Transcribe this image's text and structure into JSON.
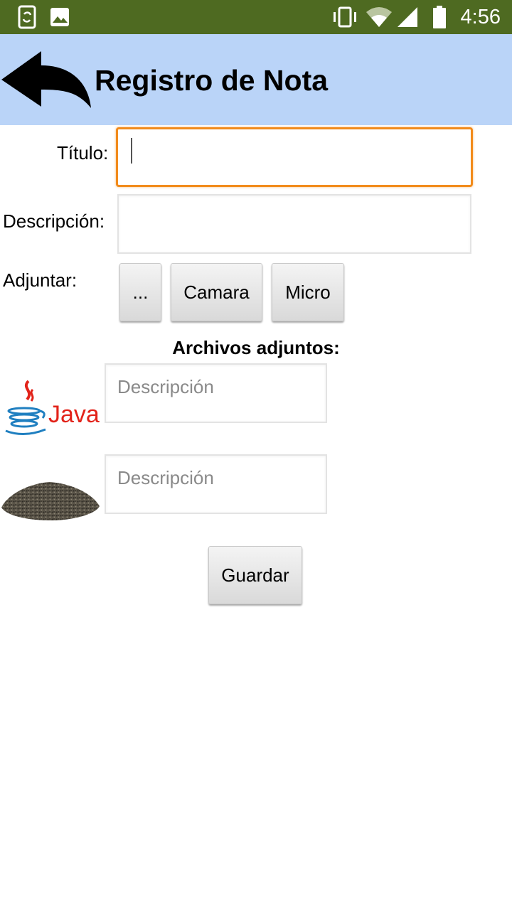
{
  "status_bar": {
    "time": "4:56",
    "icons": [
      "phone-sync-icon",
      "image-icon",
      "vibrate-icon",
      "wifi-icon",
      "signal-icon",
      "battery-icon"
    ]
  },
  "app_bar": {
    "title": "Registro de Nota",
    "back_icon": "back-arrow-icon",
    "background": "#bad4f8"
  },
  "form": {
    "titulo_label": "Título:",
    "titulo_value": "",
    "descripcion_label": "Descripción:",
    "descripcion_value": "",
    "adjuntar_label": "Adjuntar:",
    "buttons": {
      "browse": "...",
      "camera": "Camara",
      "micro": "Micro"
    }
  },
  "attachments": {
    "heading": "Archivos adjuntos:",
    "items": [
      {
        "thumbnail": "java-logo",
        "placeholder": "Descripción",
        "value": ""
      },
      {
        "thumbnail": "chia-seeds-photo",
        "placeholder": "Descripción",
        "value": ""
      }
    ]
  },
  "save_button": "Guardar",
  "colors": {
    "status_bar": "#4e6a21",
    "focus_border": "#f28b1b"
  }
}
